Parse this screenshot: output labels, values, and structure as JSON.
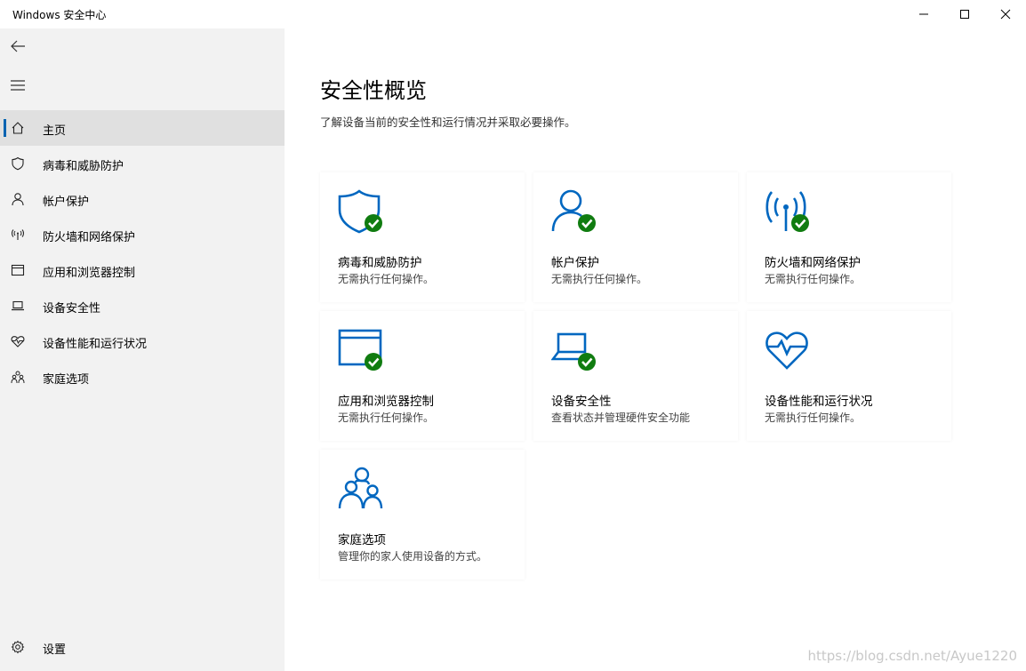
{
  "window": {
    "title": "Windows 安全中心"
  },
  "colors": {
    "accent": "#0063b1",
    "icon_blue": "#0067c0",
    "check_green": "#107c10",
    "sidebar_bg": "#f2f2f2"
  },
  "sidebar": {
    "items": [
      {
        "label": "主页",
        "icon": "home-icon",
        "active": true
      },
      {
        "label": "病毒和威胁防护",
        "icon": "shield-icon"
      },
      {
        "label": "帐户保护",
        "icon": "person-icon"
      },
      {
        "label": "防火墙和网络保护",
        "icon": "antenna-icon"
      },
      {
        "label": "应用和浏览器控制",
        "icon": "browser-window-icon"
      },
      {
        "label": "设备安全性",
        "icon": "laptop-icon"
      },
      {
        "label": "设备性能和运行状况",
        "icon": "heart-pulse-icon"
      },
      {
        "label": "家庭选项",
        "icon": "family-icon"
      }
    ],
    "settings_label": "设置"
  },
  "main": {
    "title": "安全性概览",
    "subtitle": "了解设备当前的安全性和运行情况并采取必要操作。",
    "cards": [
      {
        "title": "病毒和威胁防护",
        "desc": "无需执行任何操作。",
        "icon": "shield-icon",
        "status": "ok"
      },
      {
        "title": "帐户保护",
        "desc": "无需执行任何操作。",
        "icon": "person-icon",
        "status": "ok"
      },
      {
        "title": "防火墙和网络保护",
        "desc": "无需执行任何操作。",
        "icon": "antenna-icon",
        "status": "ok"
      },
      {
        "title": "应用和浏览器控制",
        "desc": "无需执行任何操作。",
        "icon": "browser-window-icon",
        "status": "ok"
      },
      {
        "title": "设备安全性",
        "desc": "查看状态并管理硬件安全功能",
        "icon": "laptop-icon",
        "status": "ok"
      },
      {
        "title": "设备性能和运行状况",
        "desc": "无需执行任何操作。",
        "icon": "heart-pulse-icon",
        "status": "none"
      },
      {
        "title": "家庭选项",
        "desc": "管理你的家人使用设备的方式。",
        "icon": "family-icon",
        "status": "none"
      }
    ]
  },
  "watermark": "https://blog.csdn.net/Ayue1220"
}
